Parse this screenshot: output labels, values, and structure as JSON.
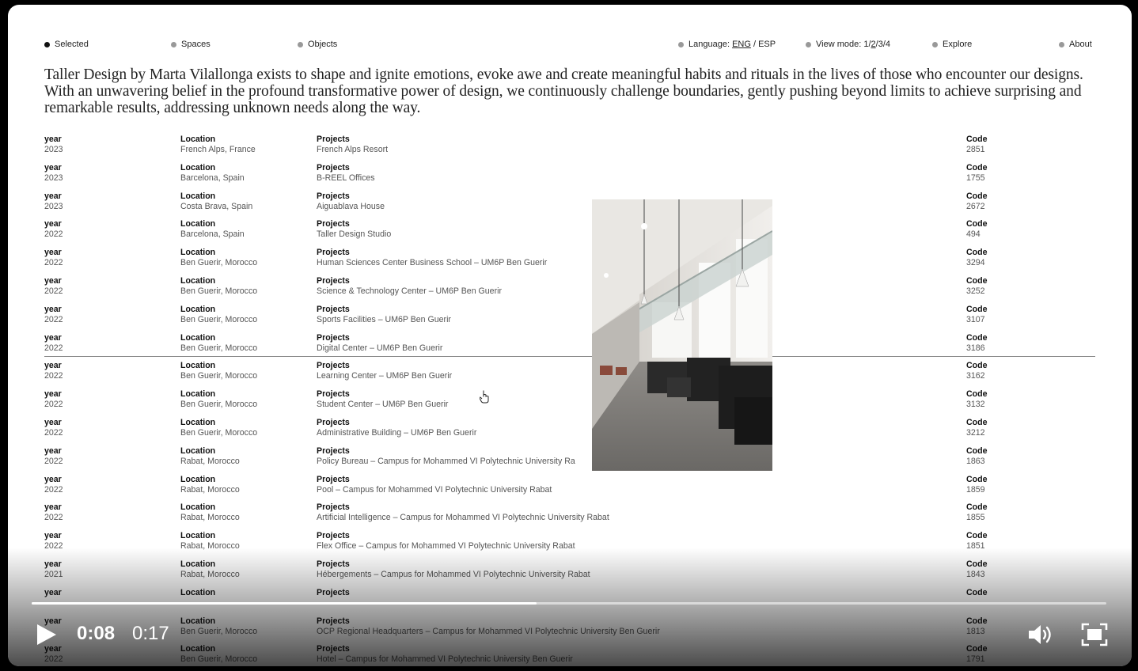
{
  "nav": {
    "selected": "Selected",
    "spaces": "Spaces",
    "objects": "Objects",
    "language_label": "Language:",
    "lang_eng": "ENG",
    "lang_sep": "/",
    "lang_esp": "ESP",
    "viewmode_label": "View mode:",
    "view_1": "1",
    "view_2": "2",
    "view_3": "3",
    "view_4": "4",
    "explore": "Explore",
    "about": "About"
  },
  "intro": "Taller Design by Marta Vilallonga exists to shape and ignite emotions, evoke awe and create meaningful habits and rituals in the lives of those who encounter our designs. With an unwavering belief in the profound transformative power of design, we continuously challenge boundaries, gently pushing beyond limits to achieve surprising and remarkable results, addressing unknown needs along the way.",
  "labels": {
    "year": "year",
    "location": "Location",
    "projects": "Projects",
    "code": "Code"
  },
  "rows": [
    {
      "year": "2023",
      "location": "French Alps, France",
      "project": "French Alps Resort",
      "code": "2851"
    },
    {
      "year": "2023",
      "location": "Barcelona, Spain",
      "project": "B-REEL Offices",
      "code": "1755"
    },
    {
      "year": "2023",
      "location": "Costa Brava, Spain",
      "project": "Aiguablava House",
      "code": "2672"
    },
    {
      "year": "2022",
      "location": "Barcelona, Spain",
      "project": "Taller Design Studio",
      "code": "494"
    },
    {
      "year": "2022",
      "location": "Ben Guerir, Morocco",
      "project": "Human Sciences Center Business School – UM6P Ben Guerir",
      "code": "3294"
    },
    {
      "year": "2022",
      "location": "Ben Guerir, Morocco",
      "project": "Science & Technology Center – UM6P Ben Guerir",
      "code": "3252"
    },
    {
      "year": "2022",
      "location": "Ben Guerir, Morocco",
      "project": "Sports Facilities – UM6P Ben Guerir",
      "code": "3107"
    },
    {
      "year": "2022",
      "location": "Ben Guerir, Morocco",
      "project": "Digital Center – UM6P Ben Guerir",
      "code": "3186"
    },
    {
      "year": "2022",
      "location": "Ben Guerir, Morocco",
      "project": "Learning Center – UM6P Ben Guerir",
      "code": "3162"
    },
    {
      "year": "2022",
      "location": "Ben Guerir, Morocco",
      "project": "Student Center – UM6P Ben Guerir",
      "code": "3132"
    },
    {
      "year": "2022",
      "location": "Ben Guerir, Morocco",
      "project": "Administrative Building – UM6P Ben Guerir",
      "code": "3212"
    },
    {
      "year": "2022",
      "location": "Rabat, Morocco",
      "project": "Policy Bureau – Campus for Mohammed VI Polytechnic University Ra",
      "code": "1863"
    },
    {
      "year": "2022",
      "location": "Rabat, Morocco",
      "project": "Pool – Campus for Mohammed VI Polytechnic University Rabat",
      "code": "1859"
    },
    {
      "year": "2022",
      "location": "Rabat, Morocco",
      "project": "Artificial Intelligence – Campus for Mohammed VI Polytechnic University Rabat",
      "code": "1855"
    },
    {
      "year": "2022",
      "location": "Rabat, Morocco",
      "project": "Flex Office – Campus for Mohammed VI Polytechnic University Rabat",
      "code": "1851"
    },
    {
      "year": "2021",
      "location": "Rabat, Morocco",
      "project": "Hébergements – Campus for Mohammed VI Polytechnic University Rabat",
      "code": "1843"
    },
    {
      "year": "",
      "location": "",
      "project": "",
      "code": ""
    },
    {
      "year": "",
      "location": "Ben Guerir, Morocco",
      "project": "OCP Regional Headquarters – Campus for Mohammed VI Polytechnic University Ben Guerir",
      "code": "1813"
    },
    {
      "year": "2022",
      "location": "Ben Guerir, Morocco",
      "project": "Hotel – Campus for Mohammed VI Polytechnic University Ben Guerir",
      "code": "1791"
    }
  ],
  "player": {
    "current_time": "0:08",
    "duration": "0:17",
    "progress_percent": 47,
    "play_icon": "play-icon",
    "volume_icon": "volume-icon",
    "fullscreen_icon": "fullscreen-icon"
  }
}
